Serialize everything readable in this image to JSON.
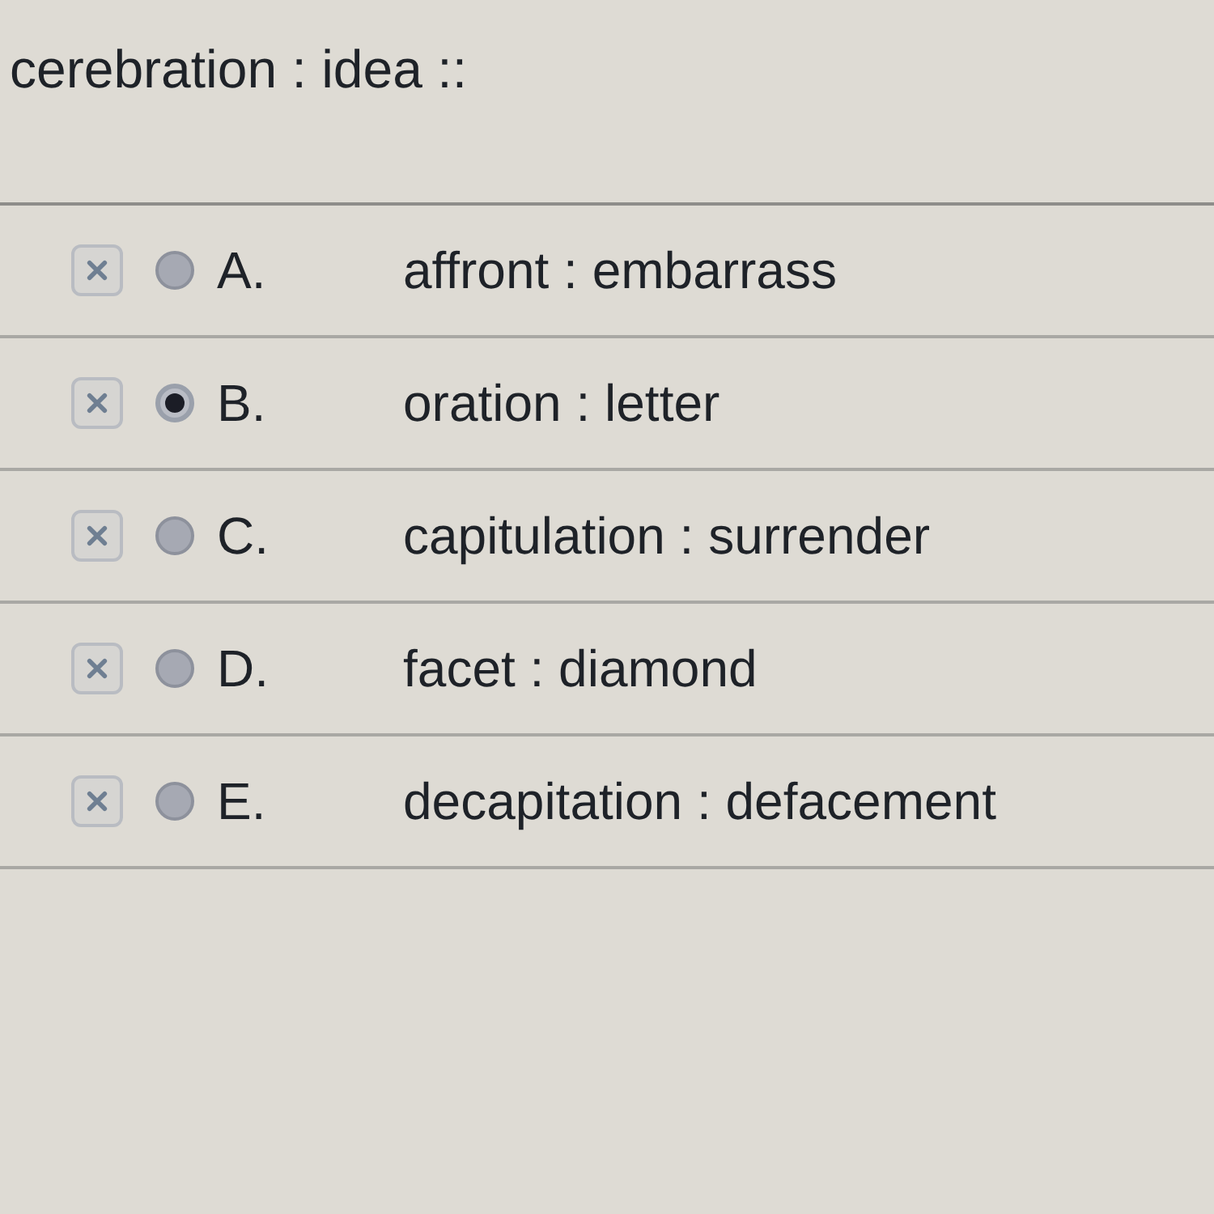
{
  "question": {
    "stem": "cerebration : idea ::"
  },
  "options": [
    {
      "letter": "A.",
      "text": "affront : embarrass",
      "selected": false
    },
    {
      "letter": "B.",
      "text": "oration : letter",
      "selected": true
    },
    {
      "letter": "C.",
      "text": "capitulation : surrender",
      "selected": false
    },
    {
      "letter": "D.",
      "text": "facet : diamond",
      "selected": false
    },
    {
      "letter": "E.",
      "text": "decapitation : defacement",
      "selected": false
    }
  ]
}
